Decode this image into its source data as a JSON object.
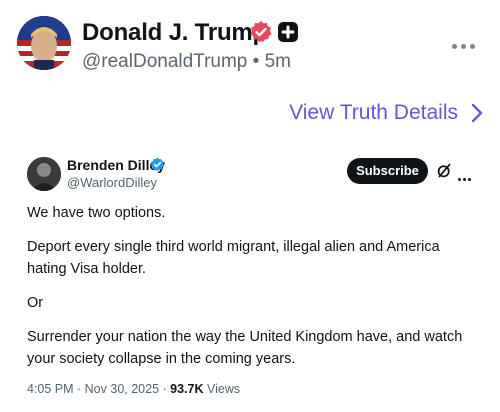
{
  "post": {
    "author_name": "Donald J. Trump",
    "handle": "@realDonaldTrump",
    "separator": "•",
    "time_ago": "5m",
    "view_details": "View Truth Details"
  },
  "quoted_tweet": {
    "author_name": "Brenden Dilley",
    "handle": "@WarlordDilley",
    "subscribe_label": "Subscribe",
    "paragraphs": [
      "We have two options.",
      "Deport every single third world migrant, illegal alien and America hating Visa holder.",
      "Or",
      "Surrender your nation the way the United Kingdom have, and watch your society collapse in the coming years."
    ],
    "timestamp": "4:05 PM · Nov 30, 2025 ·",
    "views_count": "93.7K",
    "views_label": "Views"
  },
  "colors": {
    "verified_main": "#e8485d",
    "verified_quoted": "#1d9bf0",
    "accent_link": "#6a55d1"
  },
  "icons": {
    "verified": "verified-badge-icon",
    "plus": "plus-badge-icon",
    "more": "more-icon",
    "chevron": "chevron-right-icon",
    "grok": "grok-icon"
  }
}
